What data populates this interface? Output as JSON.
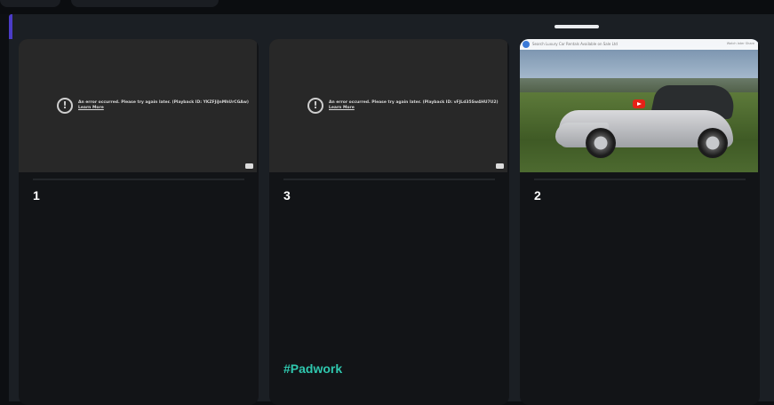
{
  "cards": [
    {
      "number": "1",
      "video": {
        "state": "error",
        "error_message": "An error occurred. Please try again later. (Playback ID: YKZFJiJnMhUrCGAw)",
        "learn_more": "Learn More",
        "icon": "error-icon"
      }
    },
    {
      "number": "3",
      "video": {
        "state": "error",
        "error_message": "An error occurred. Please try again later. (Playback ID: vFJLd35Sw4HU7U2)",
        "learn_more": "Learn More",
        "icon": "error-icon"
      },
      "hashtag": "#Padwork"
    },
    {
      "number": "2",
      "video": {
        "state": "thumbnail",
        "title": "Search Luxury Car Rentals Available on Sale Ltd",
        "header_right": "Watch later   Share",
        "icon": "youtube-play-icon"
      }
    }
  ],
  "colors": {
    "accent": "#4b3cc7",
    "hashtag": "#2fc7ae",
    "card_bg": "#121417",
    "panel_bg": "#1b1f24"
  }
}
